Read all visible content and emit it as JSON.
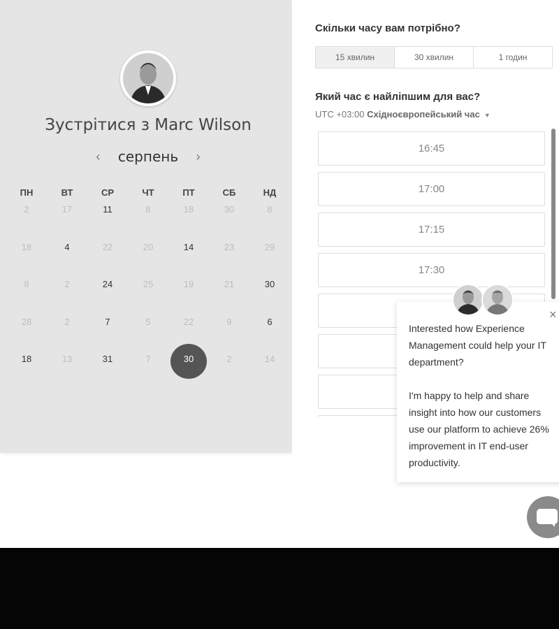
{
  "calendar": {
    "title": "Зустрітися з Marc Wilson",
    "month": "серпень",
    "prev_icon": "chevron-left-icon",
    "next_icon": "chevron-right-icon",
    "weekdays": [
      "ПН",
      "ВТ",
      "СР",
      "ЧТ",
      "ПТ",
      "СБ",
      "НД"
    ],
    "rows": [
      {
        "days": [
          "2",
          "17",
          "11",
          "8",
          "18",
          "30",
          "8"
        ],
        "active": [
          false,
          false,
          true,
          false,
          false,
          false,
          false
        ]
      },
      {
        "days": [
          "18",
          "4",
          "22",
          "20",
          "14",
          "23",
          "29"
        ],
        "active": [
          false,
          true,
          false,
          false,
          true,
          false,
          false
        ]
      },
      {
        "days": [
          "8",
          "2",
          "24",
          "25",
          "19",
          "21",
          "30"
        ],
        "active": [
          false,
          false,
          true,
          false,
          false,
          false,
          true
        ]
      },
      {
        "days": [
          "28",
          "2",
          "7",
          "5",
          "22",
          "9",
          "6"
        ],
        "active": [
          false,
          false,
          true,
          false,
          false,
          false,
          true
        ]
      },
      {
        "days": [
          "18",
          "13",
          "31",
          "7",
          "30",
          "2",
          "14"
        ],
        "active": [
          true,
          false,
          true,
          false,
          true,
          false,
          false
        ]
      }
    ],
    "selected": {
      "row": 4,
      "col": 4
    }
  },
  "booking": {
    "duration_question": "Скільки часу вам потрібно?",
    "durations": [
      "15 хвилин",
      "30 хвилин",
      "1 годин"
    ],
    "selected_duration": 0,
    "time_question": "Який час є найліпшим для вас?",
    "timezone_offset": "UTC +03:00",
    "timezone_name": "Східноєвропейський час",
    "slots": [
      "16:45",
      "17:00",
      "17:15",
      "17:30",
      "",
      "",
      "",
      ""
    ]
  },
  "chat": {
    "message_1": "Interested how Experience Management could help your IT department?",
    "message_2": "I'm happy to help and share insight into how our customers use our platform to achieve 26% improvement in IT end-user productivity.",
    "close_label": "×"
  }
}
